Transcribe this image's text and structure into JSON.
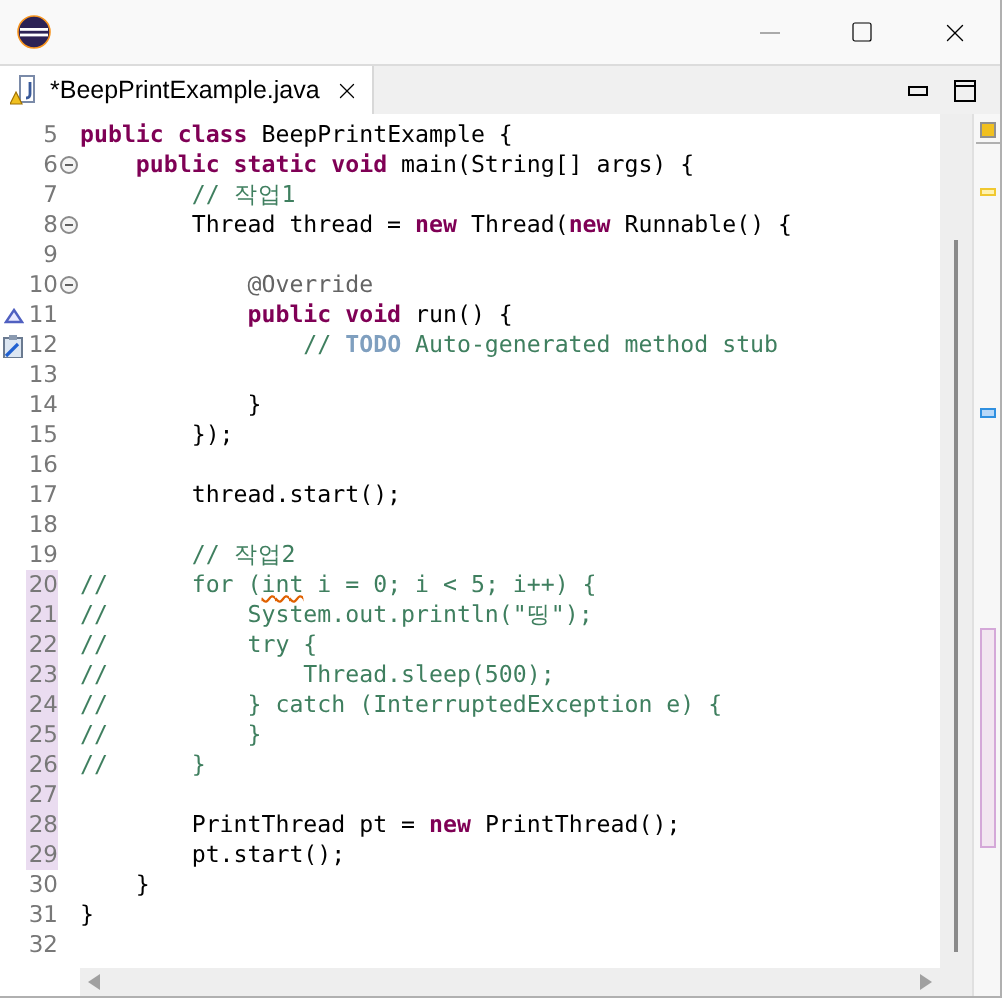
{
  "tab": {
    "label": "*BeepPrintExample.java",
    "selected": true
  },
  "lines": [
    {
      "number": "5",
      "changed": false,
      "segments": [
        {
          "text": "public class",
          "kind": "keyword"
        },
        {
          "text": " BeepPrintExample {",
          "kind": "plain"
        }
      ]
    },
    {
      "number": "6",
      "changed": false,
      "kind": "fold",
      "segments": [
        {
          "text": "    public static void",
          "kind": "keyword"
        },
        {
          "text": " main(String[] args) {",
          "kind": "plain"
        }
      ]
    },
    {
      "number": "7",
      "changed": false,
      "segments": [
        {
          "text": "        // 작업1",
          "kind": "comment"
        }
      ]
    },
    {
      "number": "8",
      "changed": false,
      "kind": "fold",
      "segments": [
        {
          "text": "        Thread thread = ",
          "kind": "plain"
        },
        {
          "text": "new",
          "kind": "keyword"
        },
        {
          "text": " Thread(",
          "kind": "plain"
        },
        {
          "text": "new",
          "kind": "keyword"
        },
        {
          "text": " Runnable() {",
          "kind": "plain"
        }
      ]
    },
    {
      "number": "9",
      "changed": false
    },
    {
      "number": "10",
      "changed": false,
      "kind": "fold",
      "segments": [
        {
          "text": "            @Override",
          "kind": "annotation"
        }
      ]
    },
    {
      "number": "11",
      "changed": false,
      "kind": "override",
      "segments": [
        {
          "text": "            public void",
          "kind": "keyword"
        },
        {
          "text": " run() {",
          "kind": "plain"
        }
      ]
    },
    {
      "number": "12",
      "changed": false,
      "kind": "task",
      "segments": [
        {
          "text": "                // ",
          "kind": "comment"
        },
        {
          "text": "TODO",
          "kind": "todo"
        },
        {
          "text": " Auto-generated method stub",
          "kind": "comment"
        }
      ]
    },
    {
      "number": "13",
      "changed": false
    },
    {
      "number": "14",
      "changed": false,
      "segments": [
        {
          "text": "            }",
          "kind": "plain"
        }
      ]
    },
    {
      "number": "15",
      "changed": false,
      "segments": [
        {
          "text": "        });",
          "kind": "plain"
        }
      ]
    },
    {
      "number": "16",
      "changed": false
    },
    {
      "number": "17",
      "changed": false,
      "segments": [
        {
          "text": "        thread.start();",
          "kind": "plain"
        }
      ]
    },
    {
      "number": "18",
      "changed": false
    },
    {
      "number": "19",
      "changed": false,
      "segments": [
        {
          "text": "        // 작업2",
          "kind": "comment"
        }
      ]
    },
    {
      "number": "20",
      "changed": true,
      "segments": [
        {
          "text": "//      for (",
          "kind": "comment"
        },
        {
          "text": "int",
          "kind": "misspelled"
        },
        {
          "text": " i = 0; i < 5; i++) {",
          "kind": "comment"
        }
      ]
    },
    {
      "number": "21",
      "changed": true,
      "segments": [
        {
          "text": "//          System.out.println(\"띵\");",
          "kind": "comment"
        }
      ]
    },
    {
      "number": "22",
      "changed": true,
      "segments": [
        {
          "text": "//          try {",
          "kind": "comment"
        }
      ]
    },
    {
      "number": "23",
      "changed": true,
      "segments": [
        {
          "text": "//              Thread.sleep(500);",
          "kind": "comment"
        }
      ]
    },
    {
      "number": "24",
      "changed": true,
      "segments": [
        {
          "text": "//          } catch (InterruptedException e) {",
          "kind": "comment"
        }
      ]
    },
    {
      "number": "25",
      "changed": true,
      "segments": [
        {
          "text": "//          }",
          "kind": "comment"
        }
      ]
    },
    {
      "number": "26",
      "changed": true,
      "segments": [
        {
          "text": "//      }",
          "kind": "comment"
        }
      ]
    },
    {
      "number": "27",
      "changed": true
    },
    {
      "number": "28",
      "changed": true,
      "segments": [
        {
          "text": "        PrintThread pt = ",
          "kind": "plain"
        },
        {
          "text": "new",
          "kind": "keyword"
        },
        {
          "text": " PrintThread();",
          "kind": "plain"
        }
      ]
    },
    {
      "number": "29",
      "changed": true,
      "segments": [
        {
          "text": "        pt.start();",
          "kind": "plain"
        }
      ]
    },
    {
      "number": "30",
      "changed": false,
      "segments": [
        {
          "text": "    }",
          "kind": "plain"
        }
      ]
    },
    {
      "number": "31",
      "changed": false,
      "segments": [
        {
          "text": "}",
          "kind": "plain"
        }
      ]
    },
    {
      "number": "32",
      "changed": false
    }
  ]
}
